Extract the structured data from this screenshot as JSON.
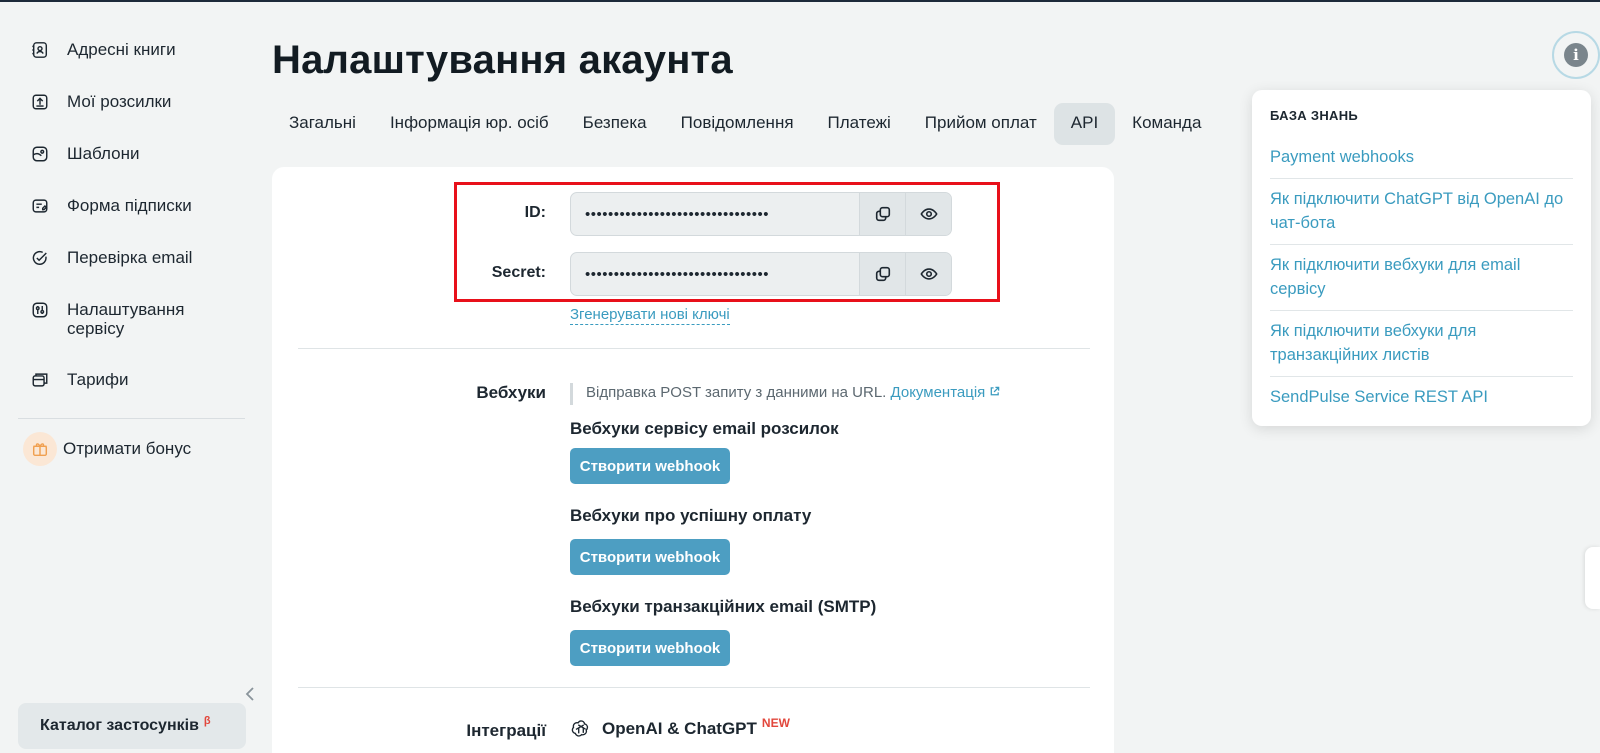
{
  "sidebar": {
    "items": [
      {
        "label": "Адресні книги",
        "icon": "address-book-icon"
      },
      {
        "label": "Мої розсилки",
        "icon": "campaigns-icon"
      },
      {
        "label": "Шаблони",
        "icon": "templates-icon"
      },
      {
        "label": "Форма підписки",
        "icon": "form-icon"
      },
      {
        "label": "Перевірка email",
        "icon": "check-circle-icon"
      },
      {
        "label": "Налаштування сервісу",
        "icon": "settings-sliders-icon"
      },
      {
        "label": "Тарифи",
        "icon": "tariffs-icon"
      }
    ],
    "bonus_label": "Отримати бонус",
    "catalog_label": "Каталог застосунків",
    "catalog_badge": "β"
  },
  "page": {
    "title": "Налаштування акаунта"
  },
  "tabs": [
    {
      "label": "Загальні",
      "active": false
    },
    {
      "label": "Інформація юр. осіб",
      "active": false
    },
    {
      "label": "Безпека",
      "active": false
    },
    {
      "label": "Повідомлення",
      "active": false
    },
    {
      "label": "Платежі",
      "active": false
    },
    {
      "label": "Прийом оплат",
      "active": false
    },
    {
      "label": "API",
      "active": true
    },
    {
      "label": "Команда",
      "active": false
    }
  ],
  "api": {
    "id_label": "ID:",
    "id_value": "••••••••••••••••••••••••••••••••",
    "secret_label": "Secret:",
    "secret_value": "••••••••••••••••••••••••••••••••",
    "generate_link": "Згенерувати нові ключі"
  },
  "webhooks": {
    "label": "Вебхуки",
    "hint": "Відправка POST запиту з данними на URL.",
    "doc_link": "Документація",
    "groups": [
      {
        "title": "Вебхуки сервісу email розсилок",
        "button": "Створити webhook"
      },
      {
        "title": "Вебхуки про успішну оплату",
        "button": "Створити webhook"
      },
      {
        "title": "Вебхуки транзакційних email (SMTP)",
        "button": "Створити webhook"
      }
    ]
  },
  "integrations": {
    "label": "Інтеграції",
    "item": "OpenAI & ChatGPT",
    "badge": "NEW"
  },
  "knowledge_base": {
    "title": "БАЗА ЗНАНЬ",
    "links": [
      "Payment webhooks",
      "Як підключити ChatGPT від OpenAI до чат-бота",
      "Як підключити вебхуки для email сервісу",
      "Як підключити вебхуки для транзакційних листів",
      "SendPulse Service REST API"
    ]
  },
  "colors": {
    "accent": "#4d9ec2",
    "link": "#3a9bbf",
    "highlight_box": "#e8101a",
    "badge_red": "#e2473c"
  }
}
